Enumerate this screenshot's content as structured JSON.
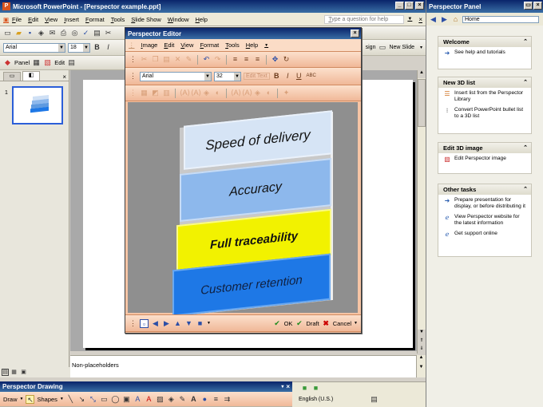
{
  "app": {
    "title": "Microsoft PowerPoint - [Perspector example.ppt]",
    "help_placeholder": "Type a question for help",
    "menu": [
      "File",
      "Edit",
      "View",
      "Insert",
      "Format",
      "Tools",
      "Slide Show",
      "Window",
      "Help"
    ],
    "font": "Arial",
    "size": "18",
    "panel_label": "Panel",
    "edit_label": "Edit",
    "design_label": "sign",
    "new_slide_label": "New Slide",
    "slide_number": "1",
    "notes_text": "Non-placeholders",
    "status_language": "English (U.S.)"
  },
  "editor": {
    "title": "Perspector Editor",
    "menu": [
      "Image",
      "Edit",
      "View",
      "Format",
      "Tools",
      "Help"
    ],
    "font": "Arial",
    "size": "32",
    "edit_text_label": "Edit Text",
    "bands": [
      {
        "label": "Speed of delivery",
        "color": "#d6e4f5"
      },
      {
        "label": "Accuracy",
        "color": "#8db8ec"
      },
      {
        "label": "Full traceability",
        "color": "#f2f200"
      },
      {
        "label": "Customer retention",
        "color": "#1e78e6"
      }
    ],
    "ok_label": "OK",
    "draft_label": "Draft",
    "cancel_label": "Cancel"
  },
  "drawing": {
    "title": "Perspector Drawing",
    "draw_label": "Draw",
    "shapes_label": "Shapes"
  },
  "panel": {
    "title": "Perspector Panel",
    "home_label": "Home",
    "sections": [
      {
        "title": "Welcome",
        "items": [
          {
            "icon": "arrow-icon",
            "text": "See help and tutorials"
          }
        ]
      },
      {
        "title": "New 3D list",
        "items": [
          {
            "icon": "list-icon",
            "text": "Insert list from the Perspector Library"
          },
          {
            "icon": "convert-icon",
            "text": "Convert PowerPoint bullet list to a 3D list"
          }
        ]
      },
      {
        "title": "Edit 3D image",
        "items": [
          {
            "icon": "edit-image-icon",
            "text": "Edit Perspector image"
          }
        ]
      },
      {
        "title": "Other tasks",
        "items": [
          {
            "icon": "arrow-icon",
            "text": "Prepare presentation for display, or before distributing it"
          },
          {
            "icon": "ie-icon",
            "text": "View Perspector website for the latest information"
          },
          {
            "icon": "ie-icon",
            "text": "Get support online"
          }
        ]
      }
    ]
  }
}
